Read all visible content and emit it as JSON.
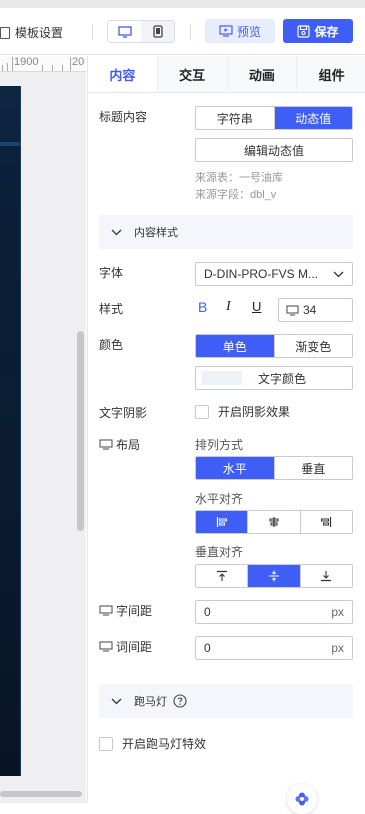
{
  "header": {
    "template_label": "模板设置",
    "preview_label": "预览",
    "save_label": "保存"
  },
  "ruler": {
    "label1": "1900",
    "label2": "20"
  },
  "tabs": [
    {
      "label": "内容",
      "active": true
    },
    {
      "label": "交互",
      "active": false
    },
    {
      "label": "动画",
      "active": false
    },
    {
      "label": "组件",
      "active": false
    }
  ],
  "title_content": {
    "label": "标题内容",
    "options": [
      "字符串",
      "动态值"
    ],
    "selected": "动态值",
    "edit_button": "编辑动态值",
    "source_table": "来源表：一号油库",
    "source_field": "来源字段：dbl_v"
  },
  "content_style": {
    "section_title": "内容样式",
    "font_label": "字体",
    "font_value": "D-DIN-PRO-FVS M...",
    "style_label": "样式",
    "bold": "B",
    "italic": "I",
    "underline": "U",
    "font_size": "34",
    "color_label": "颜色",
    "color_options": [
      "单色",
      "渐变色"
    ],
    "color_selected": "单色",
    "text_color_button": "文字颜色",
    "shadow_label": "文字阴影",
    "shadow_checkbox": "开启阴影效果",
    "layout_label": "布局",
    "arrange_label": "排列方式",
    "arrange_options": [
      "水平",
      "垂直"
    ],
    "arrange_selected": "水平",
    "halign_label": "水平对齐",
    "valign_label": "垂直对齐",
    "char_spacing_label": "字间距",
    "char_spacing_value": "0",
    "char_spacing_unit": "px",
    "word_spacing_label": "词间距",
    "word_spacing_value": "0",
    "word_spacing_unit": "px"
  },
  "marquee": {
    "section_title": "跑马灯",
    "checkbox_label": "开启跑马灯特效"
  },
  "colors": {
    "accent": "#3f5ef5",
    "accent_light": "#e8edfe"
  }
}
